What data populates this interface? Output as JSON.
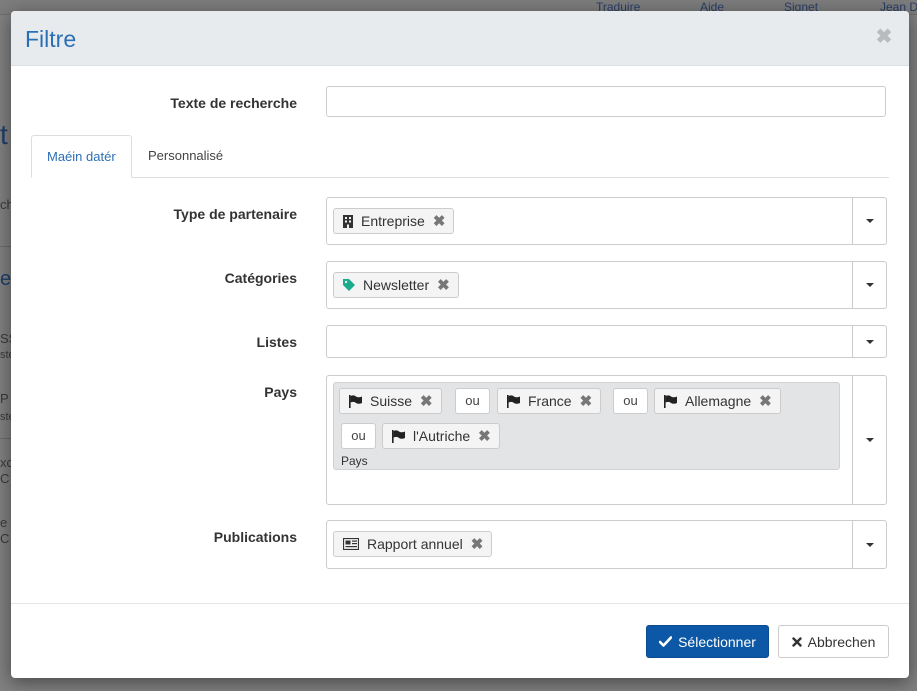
{
  "background": {
    "topbar_items": [
      "Traduire",
      "Aide",
      "Signet",
      "Jean D"
    ],
    "fragments": [
      "t",
      "ch",
      "e",
      "SS",
      "ste",
      "P",
      "ste",
      "xc",
      "C",
      "e",
      "C"
    ]
  },
  "modal": {
    "title": "Filtre",
    "close_icon": "close-icon",
    "search": {
      "label": "Texte de recherche",
      "value": "",
      "placeholder": ""
    },
    "tabs": [
      {
        "label": "Maéin datér",
        "active": true
      },
      {
        "label": "Personnalisé",
        "active": false
      }
    ],
    "fields": {
      "partner_type": {
        "label": "Type de partenaire",
        "tags": [
          {
            "label": "Entreprise",
            "icon": "building-icon"
          }
        ]
      },
      "categories": {
        "label": "Catégories",
        "tags": [
          {
            "label": "Newsletter",
            "icon": "tag-icon",
            "icon_color": "#1aaa8e"
          }
        ]
      },
      "lists": {
        "label": "Listes",
        "tags": []
      },
      "countries": {
        "label": "Pays",
        "group_label": "Pays",
        "operator": "ou",
        "tags": [
          {
            "label": "Suisse",
            "icon": "flag-icon"
          },
          {
            "label": "France",
            "icon": "flag-icon"
          },
          {
            "label": "Allemagne",
            "icon": "flag-icon"
          },
          {
            "label": "l'Autriche",
            "icon": "flag-icon"
          }
        ]
      },
      "publications": {
        "label": "Publications",
        "tags": [
          {
            "label": "Rapport annuel",
            "icon": "newspaper-icon"
          }
        ]
      }
    },
    "buttons": {
      "select": {
        "label": "Sélectionner",
        "icon": "check-icon"
      },
      "cancel": {
        "label": "Abbrechen",
        "icon": "times-icon"
      }
    },
    "colors": {
      "accent": "#2b6fb6",
      "primary_button": "#0d58a6",
      "header_bg": "#e8ebee"
    }
  }
}
